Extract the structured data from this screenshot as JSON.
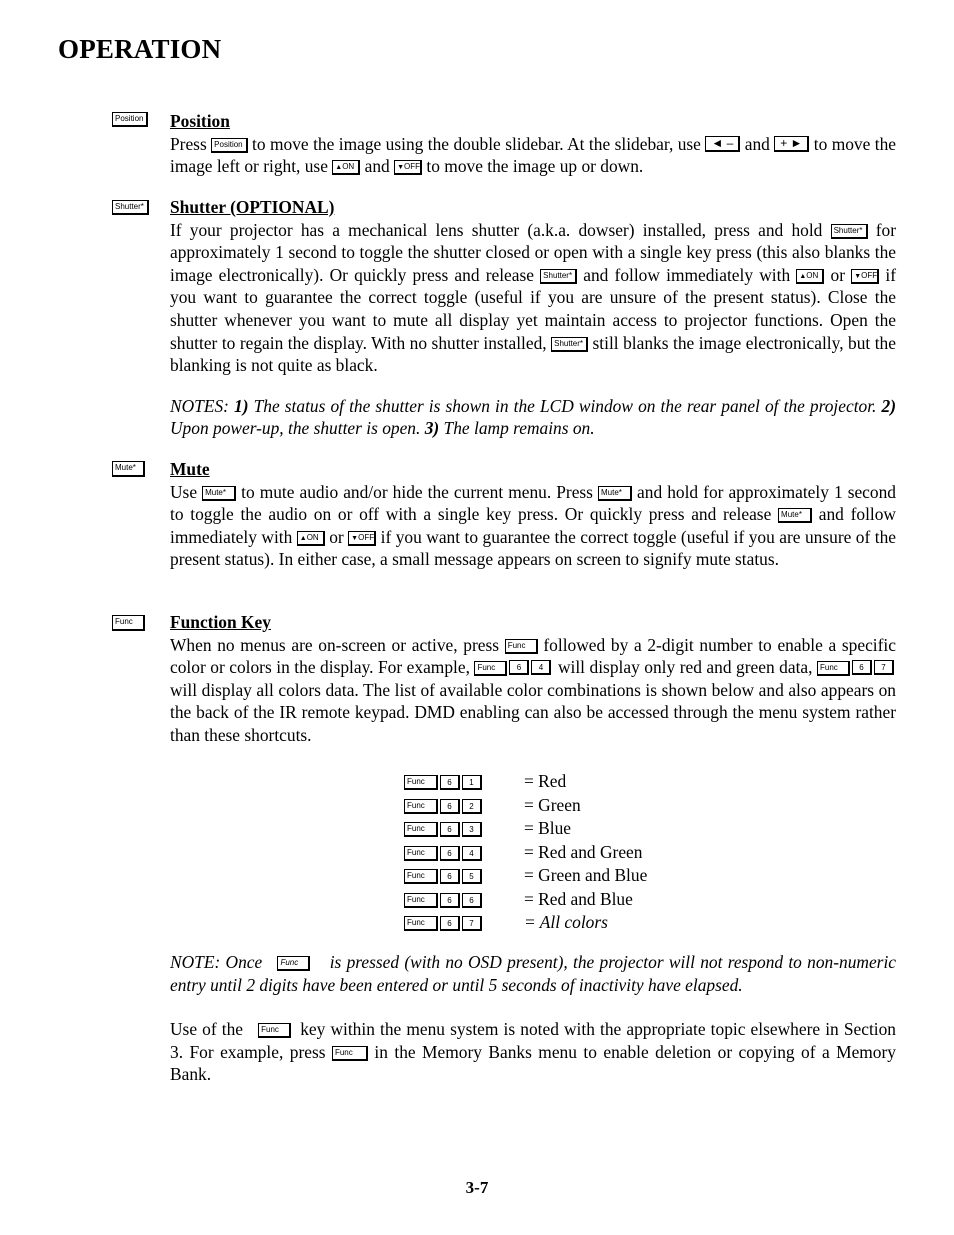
{
  "page": {
    "title": "OPERATION",
    "page_number": "3-7"
  },
  "keys": {
    "position": "Position",
    "shutter": "Shutter*",
    "mute": "Mute*",
    "func": "Func",
    "left": "◄ –",
    "right": "+ ►",
    "on_arrow": "▲",
    "on": "ON",
    "off_arrow": "▼",
    "off": "OFF"
  },
  "position": {
    "heading": "Position",
    "t1": "Press ",
    "t2": " to move the image using the double slidebar. At the slidebar, use ",
    "t3": " and ",
    "t4": " to move the image left or right, use ",
    "t5": " and ",
    "t6": " to move the image up or down."
  },
  "shutter": {
    "heading": "Shutter (OPTIONAL)",
    "t1": "If your projector has a mechanical lens shutter (a.k.a. dowser) installed, press and hold ",
    "t2": " for approximately 1 second to toggle the shutter closed or open with a single key press (this also blanks the image electronically). Or quickly press and release ",
    "t3": " and follow immediately with ",
    "t4": " or ",
    "t5": " if you want to guarantee the correct toggle (useful if you are unsure of the present status). Close the shutter whenever you want to mute all display yet maintain access to projector functions. Open the shutter to regain the display. With no shutter installed, ",
    "t6": " still blanks the image electronically, but the blanking is not quite as black.",
    "notes": {
      "prefix": "NOTES: ",
      "n1_num": "1)",
      "n1": " The status of the shutter is shown in the LCD window on the rear panel of the projector. ",
      "n2_num": "2)",
      "n2": " Upon power-up, the shutter is open. ",
      "n3_num": "3)",
      "n3": " The lamp remains on."
    }
  },
  "mute": {
    "heading": "Mute",
    "t1": "Use ",
    "t2": " to mute audio and/or hide the current menu. Press ",
    "t3": " and hold  for approximately 1 second to toggle the audio on or off with a single key press. Or quickly press and release ",
    "t4": " and follow immediately with ",
    "t5": " or ",
    "t6": " if you want to guarantee the correct toggle (useful if you are unsure of the present status). In either case, a small message appears on screen to signify mute status."
  },
  "function_key": {
    "heading": "Function Key",
    "t1": "When no menus are on-screen or active, press ",
    "t2": " followed by a 2-digit number to enable a specific color or colors in the display. For example, ",
    "example1_digits": [
      "6",
      "4"
    ],
    "t3": " will display only red and green data, ",
    "example2_digits": [
      "6",
      "7"
    ],
    "t4": " will display all colors data. The list of available color combinations is shown below and also appears on the back of the IR remote keypad. DMD enabling can also be accessed through the menu system rather than these shortcuts.",
    "combinations": [
      {
        "digits": [
          "6",
          "1"
        ],
        "label": "= Red",
        "italic": false
      },
      {
        "digits": [
          "6",
          "2"
        ],
        "label": "= Green",
        "italic": false
      },
      {
        "digits": [
          "6",
          "3"
        ],
        "label": "= Blue",
        "italic": false
      },
      {
        "digits": [
          "6",
          "4"
        ],
        "label": "= Red and Green",
        "italic": false
      },
      {
        "digits": [
          "6",
          "5"
        ],
        "label": "= Green and Blue",
        "italic": false
      },
      {
        "digits": [
          "6",
          "6"
        ],
        "label": "= Red and Blue",
        "italic": false
      },
      {
        "digits": [
          "6",
          "7"
        ],
        "label": "= All colors",
        "italic": true
      }
    ],
    "note": {
      "t1": "NOTE: Once ",
      "t2": " is pressed  (with no OSD present), the projector will not respond to non-numeric entry until 2 digits have been entered or until 5 seconds of inactivity have elapsed."
    },
    "usage": {
      "t1": "Use of the ",
      "t2": " key within the menu system is noted with the appropriate topic elsewhere in Section 3. For example, press ",
      "t3": " in the Memory Banks menu to enable deletion or copying of a Memory Bank."
    }
  }
}
